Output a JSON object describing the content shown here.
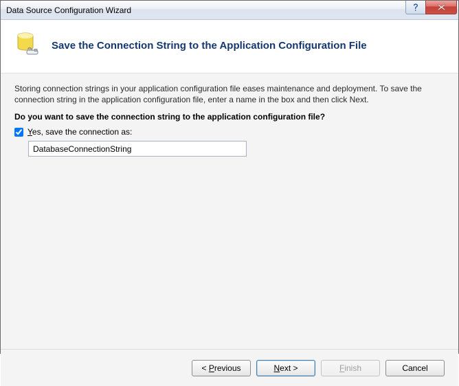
{
  "window": {
    "title": "Data Source Configuration Wizard"
  },
  "header": {
    "title": "Save the Connection String to the Application Configuration File"
  },
  "body": {
    "description": "Storing connection strings in your application configuration file eases maintenance and deployment. To save the connection string in the application configuration file, enter a name in the box and then click Next.",
    "question": "Do you want to save the connection string to the application configuration file?",
    "checkbox_prefix": "Y",
    "checkbox_rest": "es, save the connection as:",
    "connection_name": "DatabaseConnectionString"
  },
  "buttons": {
    "previous_prefix": "< ",
    "previous_u": "P",
    "previous_rest": "revious",
    "next_u": "N",
    "next_rest": "ext >",
    "finish_u": "F",
    "finish_rest": "inish",
    "cancel": "Cancel"
  }
}
